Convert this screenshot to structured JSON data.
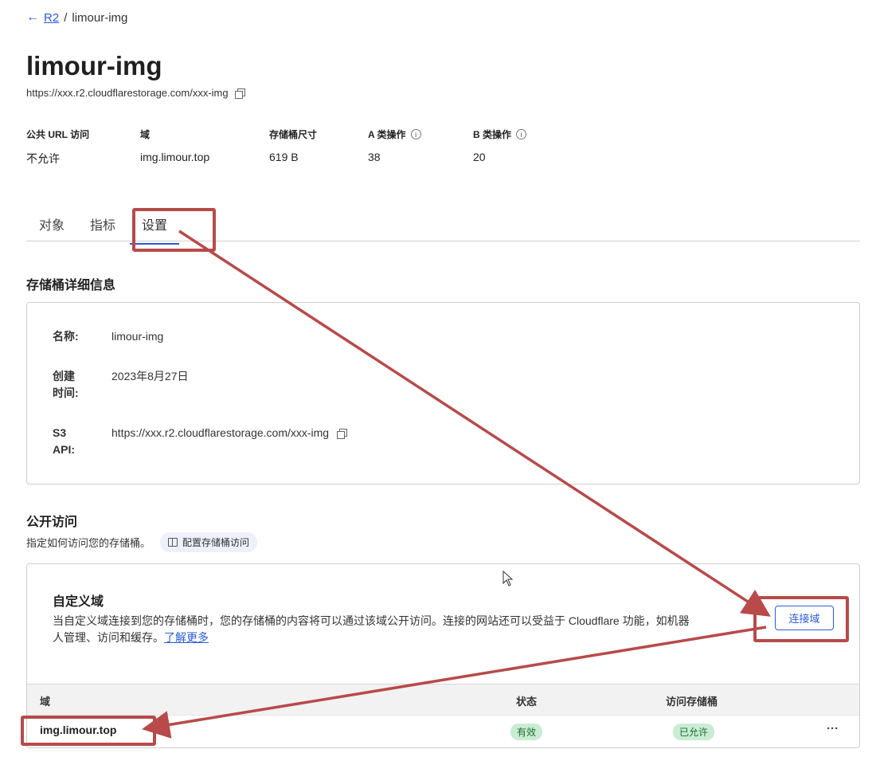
{
  "breadcrumb": {
    "back_icon": "arrow-left-icon",
    "parent": "R2",
    "separator": "/",
    "current": "limour-img"
  },
  "bucket": {
    "title": "limour-img",
    "url": "https://xxx.r2.cloudflarestorage.com/xxx-img"
  },
  "stats": [
    {
      "label": "公共 URL 访问",
      "value": "不允许",
      "info": false
    },
    {
      "label": "域",
      "value": "img.limour.top",
      "info": false
    },
    {
      "label": "存储桶尺寸",
      "value": "619 B",
      "info": false
    },
    {
      "label": "A 类操作",
      "value": "38",
      "info": true
    },
    {
      "label": "B 类操作",
      "value": "20",
      "info": true
    }
  ],
  "tabs": [
    {
      "label": "对象",
      "active": false
    },
    {
      "label": "指标",
      "active": false
    },
    {
      "label": "设置",
      "active": true
    }
  ],
  "details": {
    "title": "存储桶详细信息",
    "rows": [
      {
        "label": "名称:",
        "value": "limour-img"
      },
      {
        "label": "创建时间:",
        "value": "2023年8月27日"
      },
      {
        "label": "S3 API:",
        "value": "https://xxx.r2.cloudflarestorage.com/xxx-img"
      }
    ]
  },
  "public_access": {
    "title": "公开访问",
    "description": "指定如何访问您的存储桶。",
    "config_button": "配置存储桶访问"
  },
  "custom_domain": {
    "title": "自定义域",
    "description": "当自定义域连接到您的存储桶时，您的存储桶的内容将可以通过该域公开访问。连接的网站还可以受益于 Cloudflare 功能，如机器人管理、访问和缓存。",
    "learn_more": "了解更多",
    "connect_button": "连接域",
    "table": {
      "headers": [
        "域",
        "状态",
        "访问存储桶"
      ],
      "rows": [
        {
          "domain": "img.limour.top",
          "status": "有效",
          "access": "已允许",
          "menu": "···"
        }
      ]
    }
  },
  "colors": {
    "accent": "#2a5bd7",
    "annotation": "#b84a4a",
    "success_bg": "#c9ecd3",
    "success_text": "#1d6b34"
  }
}
